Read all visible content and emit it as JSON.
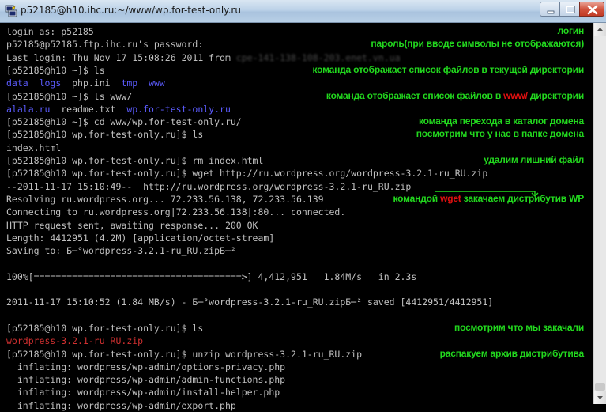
{
  "window": {
    "title": "p52185@h10.ihc.ru:~/www/wp.for-test-only.ru"
  },
  "terminal": {
    "lines": [
      [
        {
          "t": "login as: p52185"
        }
      ],
      [
        {
          "t": "p52185@p52185.ftp.ihc.ru's password:"
        }
      ],
      [
        {
          "t": "Last login: Thu Nov 17 15:08:26 2011 from "
        },
        {
          "t": "cpe-141-138-108-203.enet.vn.ua",
          "c": "ip-blur"
        }
      ],
      [
        {
          "t": "[p52185@h10 ~]$ ls"
        }
      ],
      [
        {
          "t": "data",
          "c": "blue"
        },
        {
          "t": "  "
        },
        {
          "t": "logs",
          "c": "blue"
        },
        {
          "t": "  php.ini  "
        },
        {
          "t": "tmp",
          "c": "blue"
        },
        {
          "t": "  "
        },
        {
          "t": "www",
          "c": "blue"
        }
      ],
      [
        {
          "t": "[p52185@h10 ~]$ ls www/"
        }
      ],
      [
        {
          "t": "alala.ru",
          "c": "blue"
        },
        {
          "t": "  readme.txt  "
        },
        {
          "t": "wp.for-test-only.ru",
          "c": "blue"
        }
      ],
      [
        {
          "t": "[p52185@h10 ~]$ cd www/wp.for-test-only.ru/"
        }
      ],
      [
        {
          "t": "[p52185@h10 wp.for-test-only.ru]$ ls"
        }
      ],
      [
        {
          "t": "index.html"
        }
      ],
      [
        {
          "t": "[p52185@h10 wp.for-test-only.ru]$ rm index.html"
        }
      ],
      [
        {
          "t": "[p52185@h10 wp.for-test-only.ru]$ wget http://ru.wordpress.org/wordpress-3.2.1-ru_RU.zip"
        }
      ],
      [
        {
          "t": "--2011-11-17 15:10:49--  http://ru.wordpress.org/wordpress-3.2.1-ru_RU.zip"
        }
      ],
      [
        {
          "t": "Resolving ru.wordpress.org... 72.233.56.138, 72.233.56.139"
        }
      ],
      [
        {
          "t": "Connecting to ru.wordpress.org|72.233.56.138|:80... connected."
        }
      ],
      [
        {
          "t": "HTTP request sent, awaiting response... 200 OK"
        }
      ],
      [
        {
          "t": "Length: 4412951 (4.2M) [application/octet-stream]"
        }
      ],
      [
        {
          "t": "Saving to: Б─°wordpress-3.2.1-ru_RU.zipБ─²"
        }
      ],
      [
        {
          "t": ""
        }
      ],
      [
        {
          "t": "100%[======================================>] 4,412,951   1.84M/s   in 2.3s"
        }
      ],
      [
        {
          "t": ""
        }
      ],
      [
        {
          "t": "2011-11-17 15:10:52 (1.84 MB/s) - Б─°wordpress-3.2.1-ru_RU.zipБ─² saved [4412951/4412951]"
        }
      ],
      [
        {
          "t": ""
        }
      ],
      [
        {
          "t": "[p52185@h10 wp.for-test-only.ru]$ ls"
        }
      ],
      [
        {
          "t": "wordpress-3.2.1-ru_RU.zip",
          "c": "red"
        }
      ],
      [
        {
          "t": "[p52185@h10 wp.for-test-only.ru]$ unzip wordpress-3.2.1-ru_RU.zip"
        }
      ],
      [
        {
          "t": "  inflating: wordpress/wp-admin/options-privacy.php"
        }
      ],
      [
        {
          "t": "  inflating: wordpress/wp-admin/admin-functions.php"
        }
      ],
      [
        {
          "t": "  inflating: wordpress/wp-admin/install-helper.php"
        }
      ],
      [
        {
          "t": "  inflating: wordpress/wp-admin/export.php"
        }
      ]
    ]
  },
  "annotations": [
    {
      "line": 0,
      "parts": [
        {
          "t": "логин"
        }
      ]
    },
    {
      "line": 1,
      "parts": [
        {
          "t": "пароль(при вводе символы не отображаются)"
        }
      ]
    },
    {
      "line": 3,
      "parts": [
        {
          "t": "команда отображает список файлов в текущей директории"
        }
      ]
    },
    {
      "line": 5,
      "parts": [
        {
          "t": "команда отображает список файлов в "
        },
        {
          "t": "www/",
          "hl": true
        },
        {
          "t": " директории"
        }
      ]
    },
    {
      "line": 7,
      "parts": [
        {
          "t": "команда перехода в каталог  домена"
        }
      ]
    },
    {
      "line": 8,
      "parts": [
        {
          "t": "посмотрим что у нас в папке домена"
        }
      ]
    },
    {
      "line": 10,
      "parts": [
        {
          "t": "удалим лишний файл"
        }
      ]
    },
    {
      "line": 13,
      "parts": [
        {
          "t": "командой "
        },
        {
          "t": "wget",
          "hl": true
        },
        {
          "t": " закачаем дистрибутив WP"
        }
      ]
    },
    {
      "line": 23,
      "parts": [
        {
          "t": "посмотрим что мы закачали"
        }
      ]
    },
    {
      "line": 25,
      "parts": [
        {
          "t": "распакуем архив дистрибутива"
        }
      ]
    }
  ],
  "colors": {
    "terminal_text": "#c0c0c0",
    "directory": "#5c5cff",
    "archive": "#d03030",
    "annotation": "#22d81e",
    "annotation_highlight": "#e01010"
  }
}
